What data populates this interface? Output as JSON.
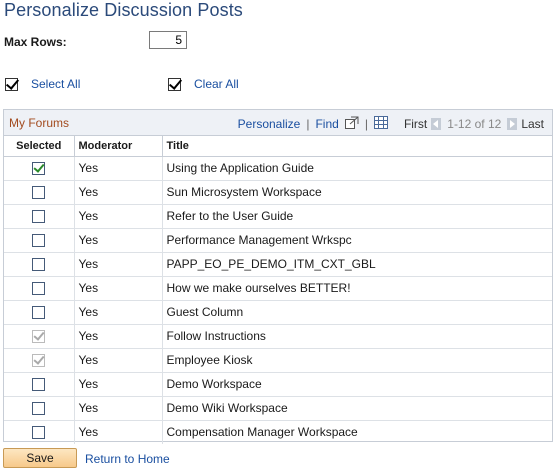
{
  "page": {
    "title": "Personalize Discussion Posts"
  },
  "max_rows": {
    "label": "Max Rows:",
    "value": "5"
  },
  "actions": {
    "select_all": "Select All",
    "clear_all": "Clear All"
  },
  "grid": {
    "title": "My Forums",
    "personalize": "Personalize",
    "find": "Find",
    "first": "First",
    "range": "1-12 of 12",
    "last": "Last",
    "columns": [
      "Selected",
      "Moderator",
      "Title"
    ],
    "rows": [
      {
        "selected": "checked",
        "moderator": "Yes",
        "title": "Using the Application Guide"
      },
      {
        "selected": "unchecked",
        "moderator": "Yes",
        "title": "Sun Microsystem Workspace"
      },
      {
        "selected": "unchecked",
        "moderator": "Yes",
        "title": "Refer to the User Guide"
      },
      {
        "selected": "unchecked",
        "moderator": "Yes",
        "title": "Performance Management Wrkspc"
      },
      {
        "selected": "unchecked",
        "moderator": "Yes",
        "title": "PAPP_EO_PE_DEMO_ITM_CXT_GBL"
      },
      {
        "selected": "unchecked",
        "moderator": "Yes",
        "title": "How we make ourselves BETTER!"
      },
      {
        "selected": "unchecked",
        "moderator": "Yes",
        "title": "Guest Column"
      },
      {
        "selected": "checked-disabled",
        "moderator": "Yes",
        "title": "Follow Instructions"
      },
      {
        "selected": "checked-disabled",
        "moderator": "Yes",
        "title": "Employee Kiosk"
      },
      {
        "selected": "unchecked",
        "moderator": "Yes",
        "title": "Demo Workspace"
      },
      {
        "selected": "unchecked",
        "moderator": "Yes",
        "title": "Demo Wiki Workspace"
      },
      {
        "selected": "unchecked",
        "moderator": "Yes",
        "title": "Compensation Manager Workspace"
      }
    ]
  },
  "footer": {
    "save": "Save",
    "return": "Return to Home"
  },
  "colors": {
    "title": "#2b4a7a",
    "link": "#1a4fa0",
    "grid_title": "#a24b1f",
    "check_green": "#2a8a2a"
  }
}
